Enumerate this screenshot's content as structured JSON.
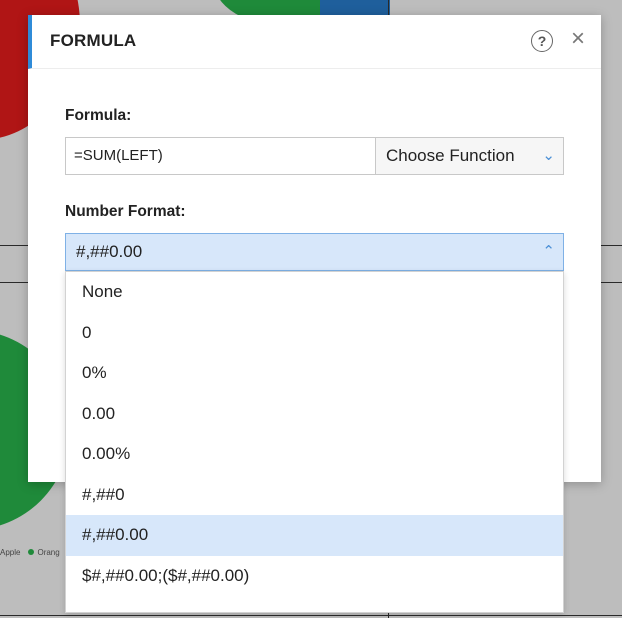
{
  "dialog": {
    "title": "FORMULA"
  },
  "formula": {
    "label": "Formula:",
    "value": "=SUM(LEFT)",
    "function_select": "Choose Function"
  },
  "number_format": {
    "label": "Number Format:",
    "selected": "#,##0.00",
    "options": [
      "None",
      "0",
      "0%",
      "0.00",
      "0.00%",
      "#,##0",
      "#,##0.00",
      "$#,##0.00;($#,##0.00)"
    ],
    "selected_index": 6
  },
  "background_legend": {
    "items": [
      "Apple",
      "Orang"
    ]
  },
  "colors": {
    "accent": "#2f8bd8",
    "selection": "#d7e7fa"
  }
}
